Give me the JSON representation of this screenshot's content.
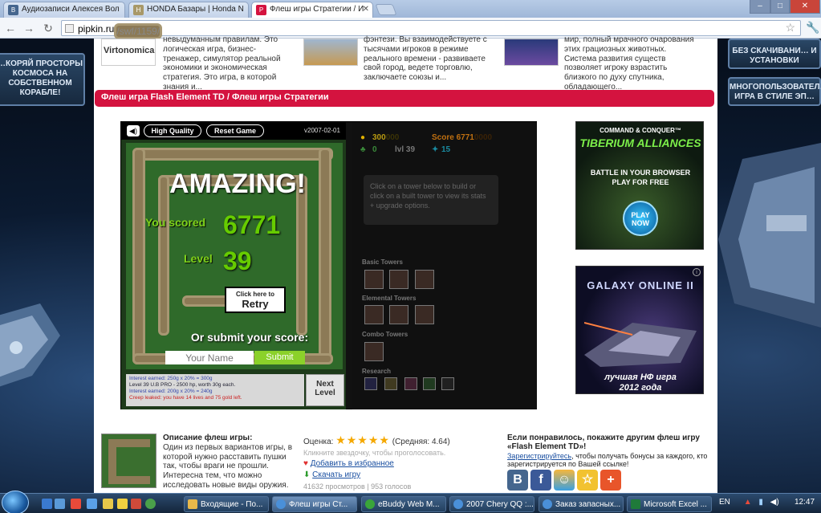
{
  "browser": {
    "tabs": [
      {
        "title": "Аудиозаписи Алексея Вол",
        "color": "#45668e",
        "fav": "В"
      },
      {
        "title": "HONDA Базары | Honda N",
        "color": "#c8b88a",
        "fav": "H"
      },
      {
        "title": "Флеш игры Стратегии / И",
        "color": "#d4133f",
        "fav": "P"
      }
    ],
    "url_host": "pipkin.ru",
    "url_path": "/swf/1159/"
  },
  "side_ads": {
    "left": "…КОРЯЙ ПРОСТОРЫ КОСМОСА НА СОБСТВЕННОМ КОРАБЛЕ!",
    "right_top": "БЕЗ СКАЧИВАНИ… И УСТАНОВКИ",
    "right_bottom": "МНОГОПОЛЬЗОВАТЕЛ… ИГРА В СТИЛЕ ЭП…"
  },
  "teasers": [
    {
      "badge": "Virtonomica",
      "text": "невыдуманным правилам. Это логическая игра, бизнес-тренажер, симулятор реальной экономики и экономическая стратегия. Это игра, в которой знания и..."
    },
    {
      "text": "фэнтези. Вы взаимодействуете с тысячами игроков в режиме реального времени - развиваете свой город, ведете торговлю, заключаете союзы и..."
    },
    {
      "text": "мир, полный мрачного очарования этих грациозных животных. Система развития существ позволяет игроку взрастить близкого по духу спутника, обладающего..."
    }
  ],
  "page_title": "Флеш игра Flash Element TD / Флеш игры Стратегии",
  "game": {
    "high_quality": "High Quality",
    "reset_game": "Reset Game",
    "version": "v2007-02-01",
    "amazing": "AMAZING!",
    "you_scored_label": "You scored",
    "score": "6771",
    "level_label": "Level",
    "level": "39",
    "retry_small": "Click here to",
    "retry_big": "Retry",
    "submit_prompt": "Or submit your score:",
    "name_placeholder": "Your Name",
    "submit": "Submit",
    "info": [
      "Interest earned: 250g x 20% = 300g",
      "Level 39 U.B PRO - 2500 hp, worth 30g each.",
      "Interest earned: 200g x 20% = 240g",
      "Creep leaked: you have 14 lives and 75 gold left."
    ],
    "next_level": "Next Level",
    "gold": "300",
    "gold_ghost": "000",
    "score_label": "Score 6771",
    "score_ghost": "0000",
    "lives": "0",
    "lvl": "lvl 39",
    "creeps": "15",
    "help": "Click on a tower below to build or click on a built tower to view its stats + upgrade options.",
    "basic_towers": "Basic Towers",
    "elemental_towers": "Elemental Towers",
    "combo_towers": "Combo Towers",
    "research": "Research"
  },
  "ads": {
    "ad1_top": "COMMAND & CONQUER™",
    "ad1_title": "TIBERIUM ALLIANCES",
    "ad1_sub1": "BATTLE IN YOUR BROWSER",
    "ad1_sub2": "PLAY FOR FREE",
    "ad1_play": "PLAY NOW",
    "ad2_title": "GALAXY ONLINE II",
    "ad2_caption1": "лучшая НФ игра",
    "ad2_caption2": "2012 года"
  },
  "description": {
    "title": "Описание флеш игры:",
    "text": "Один из первых вариантов игры, в которой нужно расставить пушки так, чтобы враги не прошли. Интересна тем, что можно исследовать новые виды оружия."
  },
  "rating": {
    "label": "Оценка:",
    "average": "(Средняя: 4.64)",
    "vote_hint": "Кликните звездочку, чтобы проголосовать.",
    "favorites": "Добавить в избранное",
    "download": "Скачать игру",
    "stats": "41632 просмотров | 953 голосов"
  },
  "share": {
    "title": "Если понравилось, покажите другим флеш игру «Flash Element TD»!",
    "register_link": "Зарегистрируйтесь",
    "register_text": ", чтобы получать бонусы за каждого, кто зарегистрируется по Вашей ссылке!"
  },
  "taskbar": {
    "tasks": [
      {
        "label": "Входящие - По...",
        "color": "#e8b84a"
      },
      {
        "label": "Флеш игры Ст...",
        "color": "#4a90d9",
        "active": true
      },
      {
        "label": "eBuddy Web M...",
        "color": "#3aa53a"
      },
      {
        "label": "2007 Chery QQ :...",
        "color": "#4a90d9"
      },
      {
        "label": "Заказ запасных...",
        "color": "#4a90d9"
      },
      {
        "label": "Microsoft Excel ...",
        "color": "#1f7a3a"
      }
    ],
    "lang": "EN",
    "clock": "12:47"
  }
}
